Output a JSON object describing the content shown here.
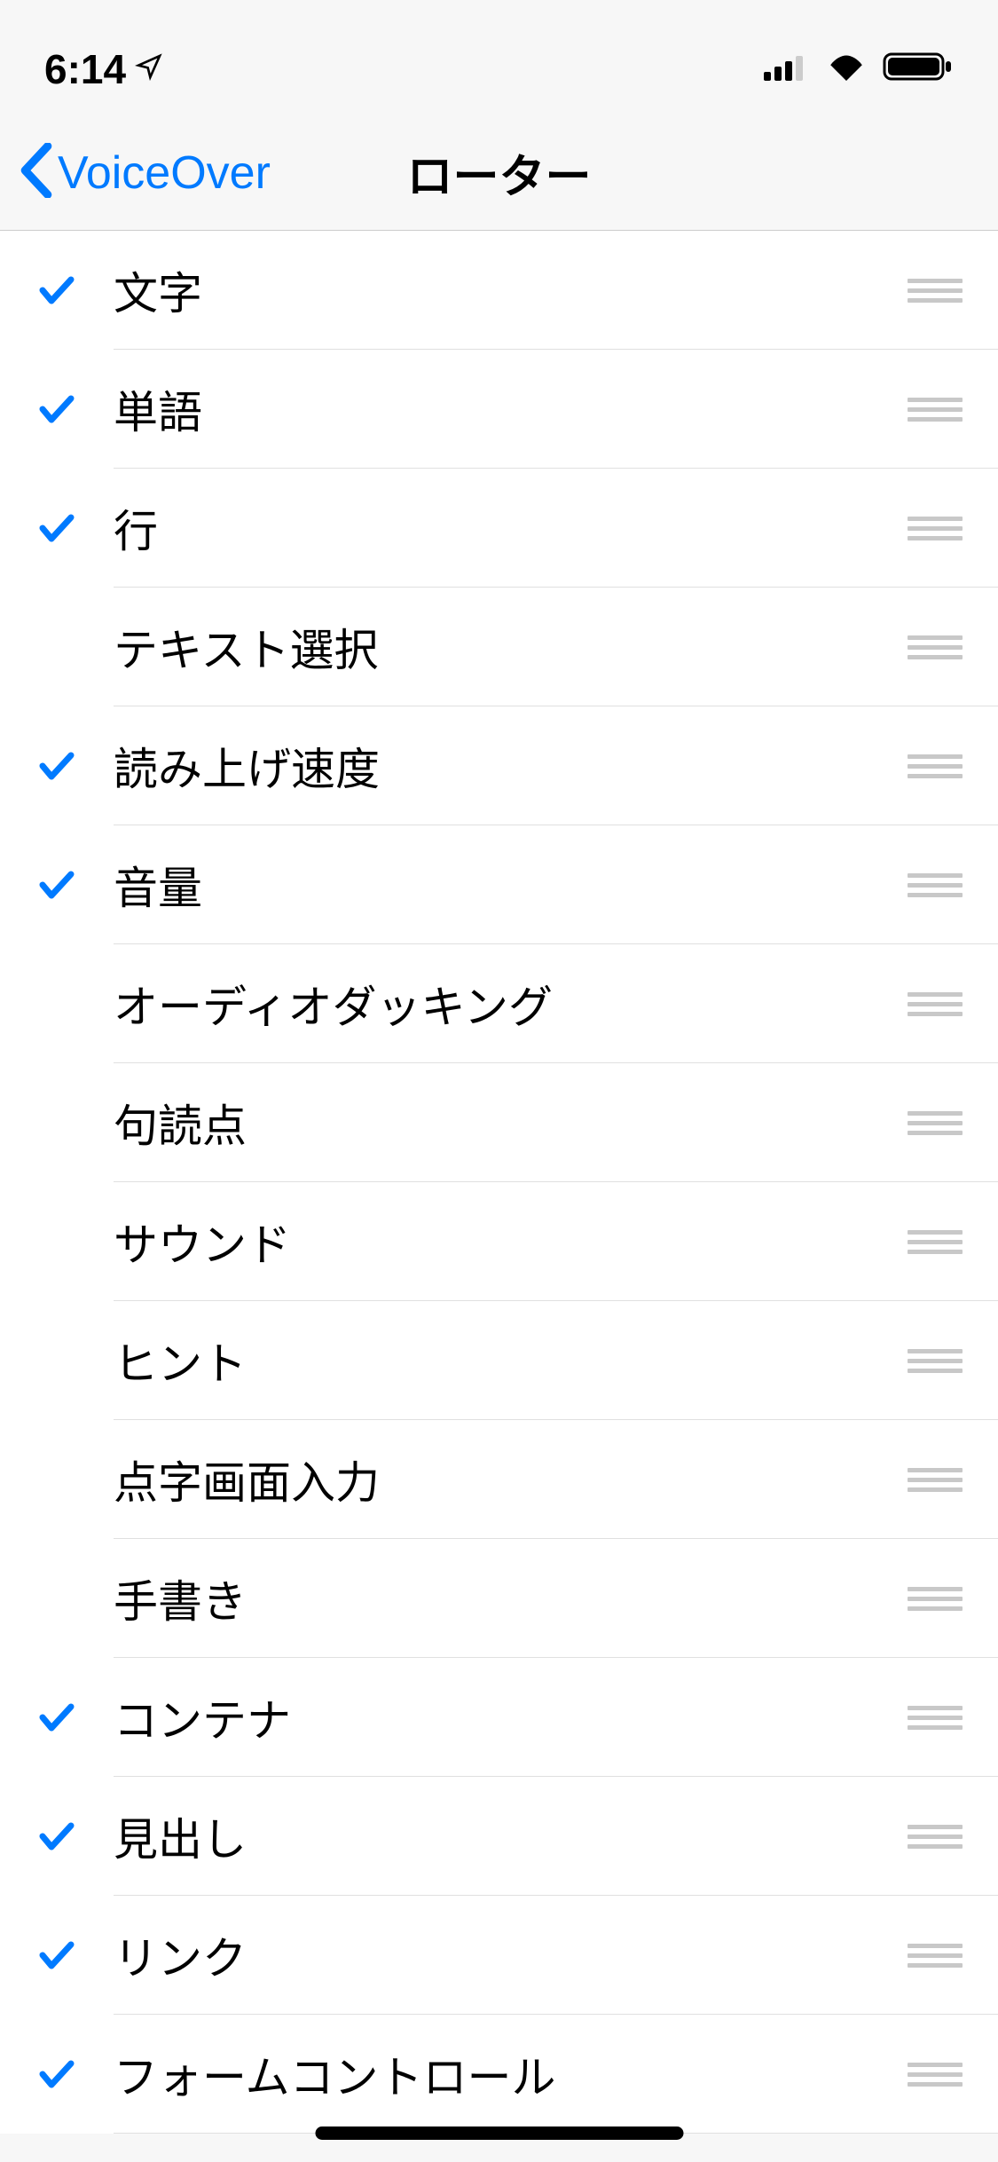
{
  "statusBar": {
    "time": "6:14"
  },
  "navBar": {
    "backLabel": "VoiceOver",
    "title": "ローター"
  },
  "rotorItems": [
    {
      "label": "文字",
      "checked": true
    },
    {
      "label": "単語",
      "checked": true
    },
    {
      "label": "行",
      "checked": true
    },
    {
      "label": "テキスト選択",
      "checked": false
    },
    {
      "label": "読み上げ速度",
      "checked": true
    },
    {
      "label": "音量",
      "checked": true
    },
    {
      "label": "オーディオダッキング",
      "checked": false
    },
    {
      "label": "句読点",
      "checked": false
    },
    {
      "label": "サウンド",
      "checked": false
    },
    {
      "label": "ヒント",
      "checked": false
    },
    {
      "label": "点字画面入力",
      "checked": false
    },
    {
      "label": "手書き",
      "checked": false
    },
    {
      "label": "コンテナ",
      "checked": true
    },
    {
      "label": "見出し",
      "checked": true
    },
    {
      "label": "リンク",
      "checked": true
    },
    {
      "label": "フォームコントロール",
      "checked": true
    }
  ]
}
